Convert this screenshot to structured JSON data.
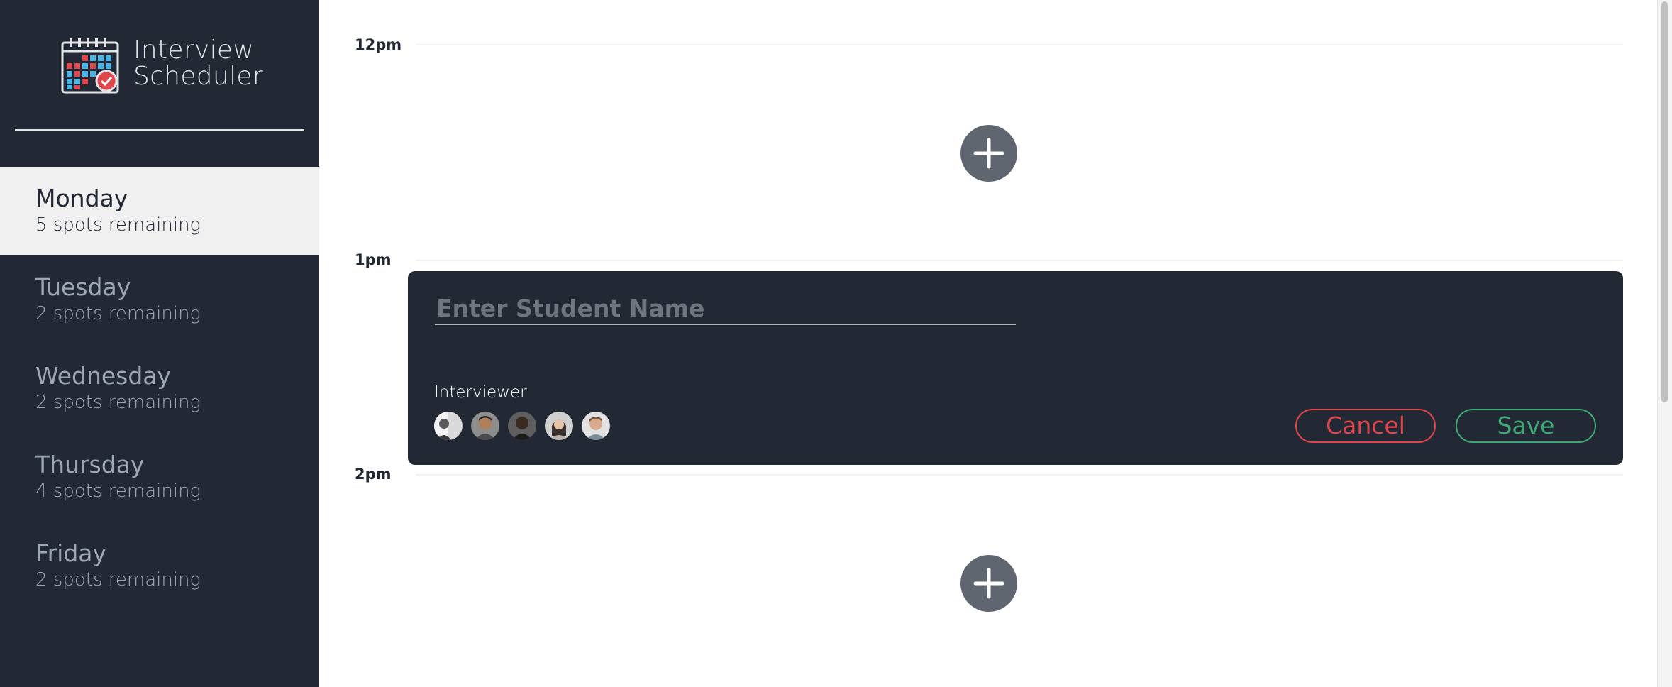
{
  "brand": {
    "line1": "Interview",
    "line2": "Scheduler"
  },
  "days": [
    {
      "name": "Monday",
      "spots": "5 spots remaining",
      "selected": true
    },
    {
      "name": "Tuesday",
      "spots": "2 spots remaining",
      "selected": false
    },
    {
      "name": "Wednesday",
      "spots": "2 spots remaining",
      "selected": false
    },
    {
      "name": "Thursday",
      "spots": "4 spots remaining",
      "selected": false
    },
    {
      "name": "Friday",
      "spots": "2 spots remaining",
      "selected": false
    }
  ],
  "schedule": {
    "times": [
      "12pm",
      "1pm",
      "2pm"
    ],
    "add_icon": "plus-icon"
  },
  "form": {
    "placeholder": "Enter Student Name",
    "value": "",
    "interviewer_label": "Interviewer",
    "cancel_label": "Cancel",
    "save_label": "Save"
  },
  "colors": {
    "sidebar_bg": "#222935",
    "selected_day_bg": "#f0f0f0",
    "cancel": "#e0474c",
    "save": "#3fa877",
    "add_button": "#606670"
  }
}
